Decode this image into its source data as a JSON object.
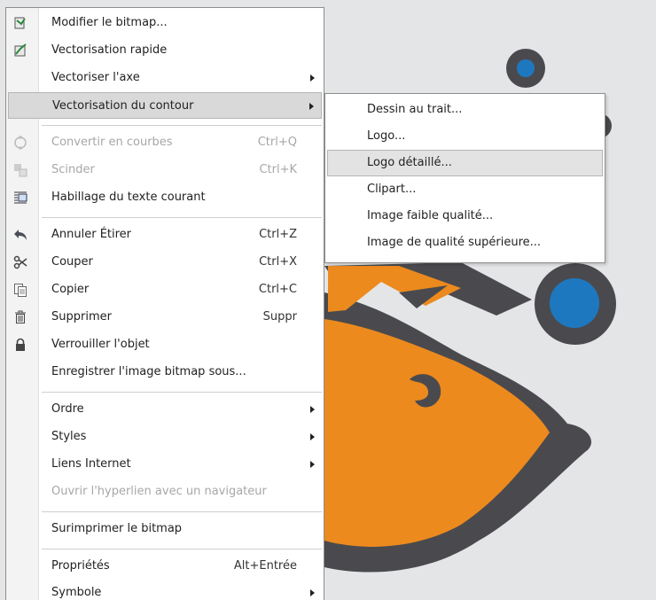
{
  "colors": {
    "orange": "#ec8a1e",
    "blue": "#1e78c0",
    "dark": "#4a4a4e",
    "canvas": "#e4e5e7"
  },
  "menu": {
    "items": [
      {
        "label": "Modifier le bitmap...",
        "shortcut": "",
        "icon": "edit-bitmap-icon",
        "submenu": false,
        "disabled": false
      },
      {
        "label": "Vectorisation rapide",
        "shortcut": "",
        "icon": "quick-trace-icon",
        "submenu": false,
        "disabled": false
      },
      {
        "label": "Vectoriser l'axe",
        "shortcut": "",
        "icon": "",
        "submenu": true,
        "disabled": false
      },
      {
        "label": "Vectorisation du contour",
        "shortcut": "",
        "icon": "",
        "submenu": true,
        "disabled": false
      },
      {
        "label": "Convertir en courbes",
        "shortcut": "Ctrl+Q",
        "icon": "convert-curves-icon",
        "submenu": false,
        "disabled": true
      },
      {
        "label": "Scinder",
        "shortcut": "Ctrl+K",
        "icon": "break-apart-icon",
        "submenu": false,
        "disabled": true
      },
      {
        "label": "Habillage du texte courant",
        "shortcut": "",
        "icon": "wrap-text-icon",
        "submenu": false,
        "disabled": false
      },
      {
        "label": "Annuler Étirer",
        "shortcut": "Ctrl+Z",
        "icon": "undo-icon",
        "submenu": false,
        "disabled": false
      },
      {
        "label": "Couper",
        "shortcut": "Ctrl+X",
        "icon": "scissors-icon",
        "submenu": false,
        "disabled": false
      },
      {
        "label": "Copier",
        "shortcut": "Ctrl+C",
        "icon": "copy-icon",
        "submenu": false,
        "disabled": false
      },
      {
        "label": "Supprimer",
        "shortcut": "Suppr",
        "icon": "trash-icon",
        "submenu": false,
        "disabled": false
      },
      {
        "label": "Verrouiller l'objet",
        "shortcut": "",
        "icon": "lock-icon",
        "submenu": false,
        "disabled": false
      },
      {
        "label": "Enregistrer l'image bitmap sous...",
        "shortcut": "",
        "icon": "",
        "submenu": false,
        "disabled": false
      },
      {
        "label": "Ordre",
        "shortcut": "",
        "icon": "",
        "submenu": true,
        "disabled": false
      },
      {
        "label": "Styles",
        "shortcut": "",
        "icon": "",
        "submenu": true,
        "disabled": false
      },
      {
        "label": "Liens Internet",
        "shortcut": "",
        "icon": "",
        "submenu": true,
        "disabled": false
      },
      {
        "label": "Ouvrir l'hyperlien avec un navigateur",
        "shortcut": "",
        "icon": "",
        "submenu": false,
        "disabled": true
      },
      {
        "label": "Surimprimer le bitmap",
        "shortcut": "",
        "icon": "",
        "submenu": false,
        "disabled": false
      },
      {
        "label": "Propriétés",
        "shortcut": "Alt+Entrée",
        "icon": "",
        "submenu": false,
        "disabled": false
      },
      {
        "label": "Symbole",
        "shortcut": "",
        "icon": "",
        "submenu": true,
        "disabled": false
      }
    ]
  },
  "submenu": {
    "items": [
      {
        "label": "Dessin au trait..."
      },
      {
        "label": "Logo..."
      },
      {
        "label": "Logo détaillé..."
      },
      {
        "label": "Clipart..."
      },
      {
        "label": "Image faible qualité..."
      },
      {
        "label": "Image de qualité supérieure..."
      }
    ]
  }
}
